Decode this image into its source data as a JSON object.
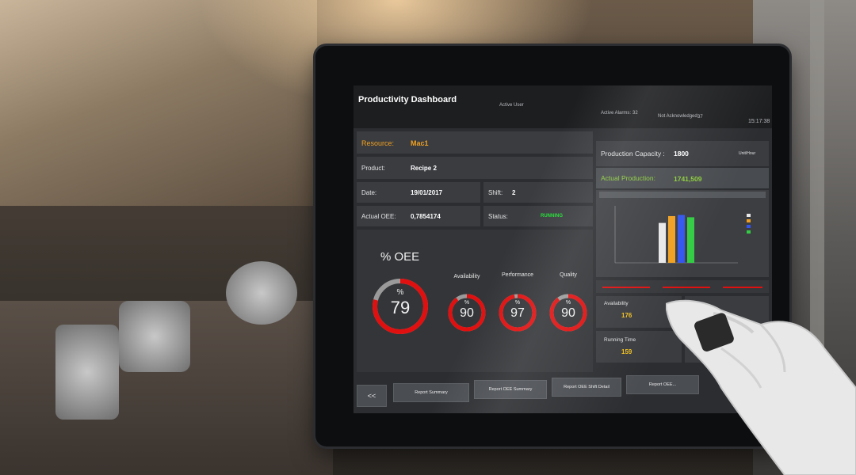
{
  "app": {
    "title": "Productivity Dashboard",
    "active_user_label": "Active User",
    "active_alarms_label": "Active Alarms:",
    "active_alarms_value": "32",
    "not_acknowledged_label": "Not Acknowledged:",
    "not_acknowledged_value": "37",
    "time": "15:17:38"
  },
  "resource": {
    "label": "Resource:",
    "value": "Mac1"
  },
  "product": {
    "label": "Product:",
    "value": "Recipe 2"
  },
  "date": {
    "label": "Date:",
    "value": "19/01/2017"
  },
  "shift": {
    "label": "Shift:",
    "value": "2"
  },
  "actual_oee": {
    "label": "Actual OEE:",
    "value": "0,7854174"
  },
  "status": {
    "label": "Status:",
    "value": "RUNNING"
  },
  "production_capacity": {
    "label": "Production Capacity :",
    "value": "1800",
    "unit": "Unit/Hour"
  },
  "actual_production": {
    "label": "Actual Production:",
    "value": "1741,509"
  },
  "oee": {
    "title": "% OEE",
    "percent_sign": "%",
    "value": 79
  },
  "gauges": [
    {
      "label": "Availability",
      "percent_sign": "%",
      "value": 90
    },
    {
      "label": "Performance",
      "percent_sign": "%",
      "value": 97
    },
    {
      "label": "Quality",
      "percent_sign": "%",
      "value": 90
    }
  ],
  "lower_right": {
    "availability_label": "Availability",
    "availability_value": "176",
    "running_time_label": "Running Time",
    "running_time_value": "159"
  },
  "chart_data": {
    "type": "bar",
    "categories": [
      "Mac1"
    ],
    "series": [
      {
        "name": "",
        "values": [
          70
        ],
        "color": "#e8e8e8"
      },
      {
        "name": "",
        "values": [
          82
        ],
        "color": "#f0a020"
      },
      {
        "name": "",
        "values": [
          84
        ],
        "color": "#3355ee"
      },
      {
        "name": "",
        "values": [
          80
        ],
        "color": "#33cc44"
      }
    ],
    "ylim": [
      0,
      100
    ]
  },
  "nav": {
    "back_label": "<<",
    "buttons": [
      "Report Summary",
      "Report OEE Summary",
      "Report OEE Shift Detail",
      "Report OEE..."
    ]
  },
  "colors": {
    "accent_orange": "#f0a020",
    "gauge_red": "#e01010",
    "status_green": "#22dd33",
    "actual_production_green": "#8ccf3a"
  }
}
